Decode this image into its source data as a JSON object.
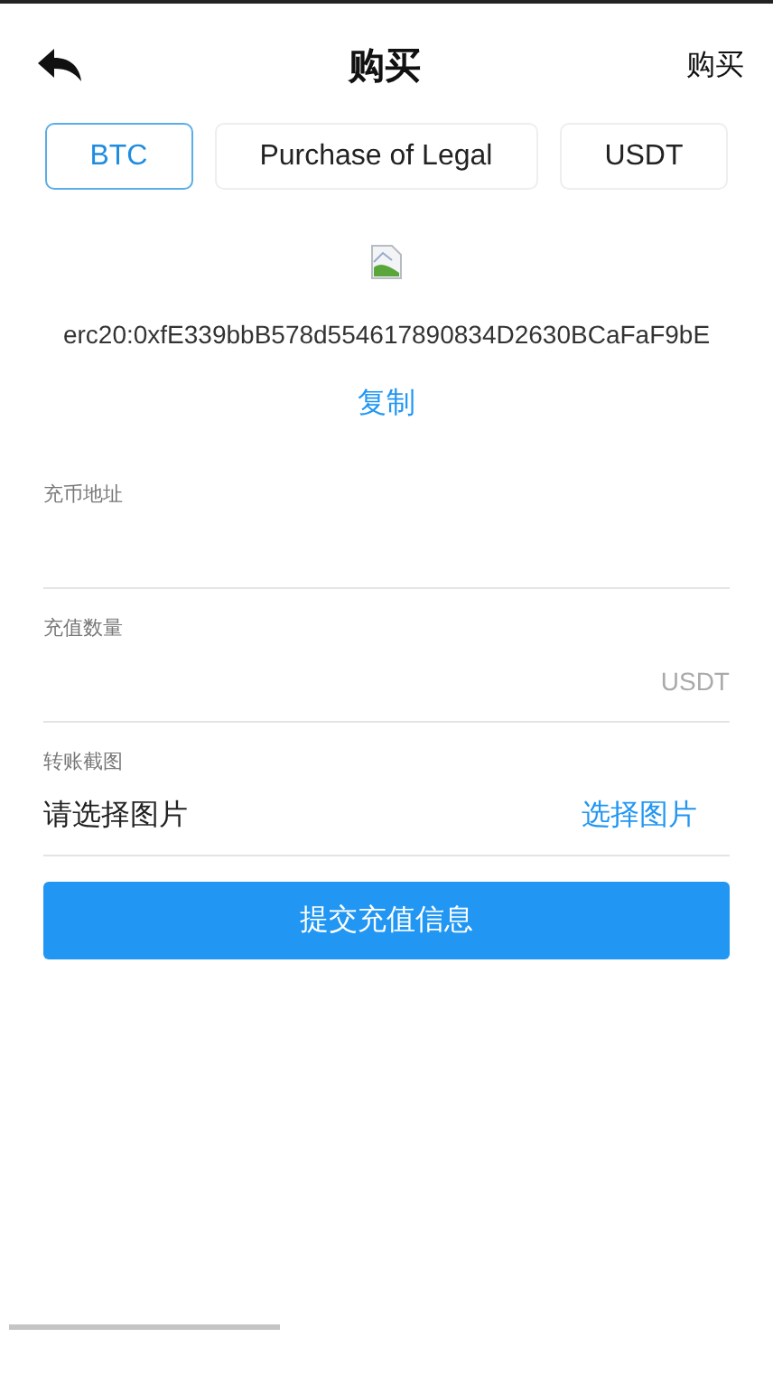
{
  "header": {
    "title": "购买",
    "action": "购买"
  },
  "tabs": [
    {
      "label": "BTC",
      "selected": true
    },
    {
      "label": "Purchase of Legal",
      "selected": false
    },
    {
      "label": "USDT",
      "selected": false
    }
  ],
  "address": "erc20:0xfE339bbB578d554617890834D2630BCaFaF9bE",
  "copy": "复制",
  "fields": [
    {
      "kind": "input",
      "label": "充币地址"
    },
    {
      "kind": "amount",
      "label": "充值数量",
      "suffix": "USDT"
    },
    {
      "kind": "image",
      "label": "转账截图",
      "placeholder": "请选择图片",
      "action": "选择图片"
    }
  ],
  "submit": "提交充值信息"
}
